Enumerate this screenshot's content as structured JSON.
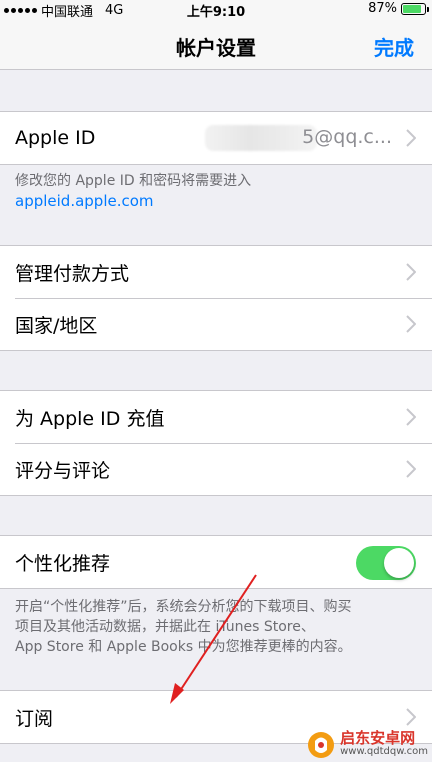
{
  "status": {
    "carrier": "中国联通",
    "network": "4G",
    "time": "上午9:10",
    "battery_text": "87%",
    "battery_level": 0.87
  },
  "nav": {
    "title": "帐户设置",
    "done": "完成"
  },
  "apple_id": {
    "label": "Apple ID",
    "value": "5@qq.c...",
    "footer_line1": "修改您的 Apple ID 和密码将需要进入",
    "footer_link": "appleid.apple.com"
  },
  "payment": {
    "manage": "管理付款方式",
    "region": "国家/地区"
  },
  "store": {
    "topup": "为 Apple ID 充值",
    "ratings": "评分与评论"
  },
  "personalized": {
    "label": "个性化推荐",
    "toggle_on": true,
    "footer_line1": "开启“个性化推荐”后，系统会分析您的下载项目、购买",
    "footer_line2": "项目及其他活动数据，并据此在 iTunes Store、",
    "footer_line3": "App Store 和 Apple Books 中为您推荐更棒的内容。"
  },
  "subscriptions": {
    "label": "订阅"
  },
  "watermark": {
    "name": "启东安卓网",
    "url": "www.qdtdqw.com"
  },
  "colors": {
    "accent": "#007aff",
    "toggle": "#4cd964",
    "annotation": "#e02020"
  }
}
